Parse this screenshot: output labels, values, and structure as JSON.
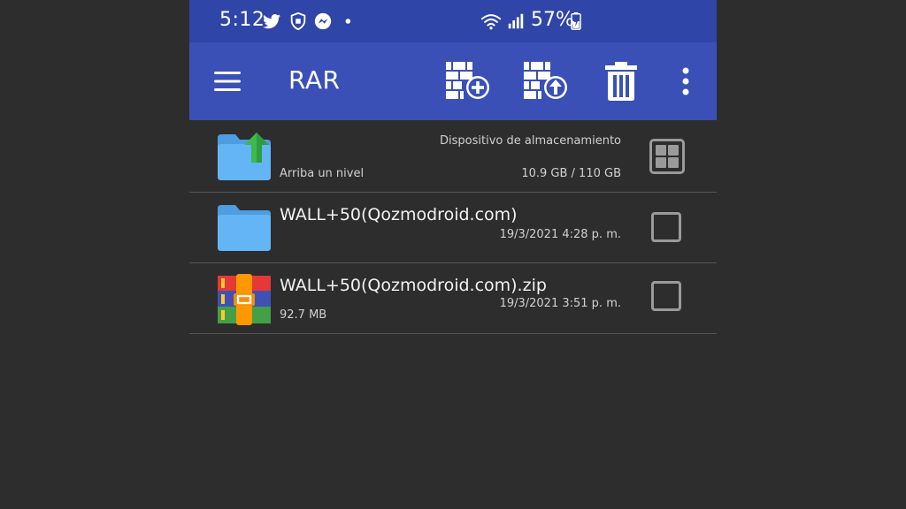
{
  "status_bar": {
    "time": "5:12",
    "battery": "57%",
    "icons": [
      "twitter-icon",
      "shield-icon",
      "messenger-icon",
      "dot-icon",
      "wifi-icon",
      "signal-icon",
      "battery-icon"
    ]
  },
  "toolbar": {
    "title": "RAR",
    "buttons": [
      "menu-icon",
      "add-to-archive-icon",
      "extract-icon",
      "delete-icon",
      "more-vert-icon"
    ]
  },
  "list": {
    "up_level": {
      "label": "Arriba un nivel",
      "storage_label": "Dispositivo de almacenamiento",
      "storage_value": "10.9 GB / 110 GB"
    },
    "items": [
      {
        "name": "WALL+50(Qozmodroid.com)",
        "date": "19/3/2021 4:28 p. m.",
        "size": "",
        "type": "folder"
      },
      {
        "name": "WALL+50(Qozmodroid.com).zip",
        "date": "19/3/2021 3:51 p. m.",
        "size": "92.7 MB",
        "type": "archive"
      }
    ]
  },
  "colors": {
    "status_bar": "#2f45a8",
    "toolbar": "#3a50b7",
    "background": "#2d2d2d",
    "folder_blue": "#64b5f6",
    "up_arrow_green": "#3dba4e"
  }
}
